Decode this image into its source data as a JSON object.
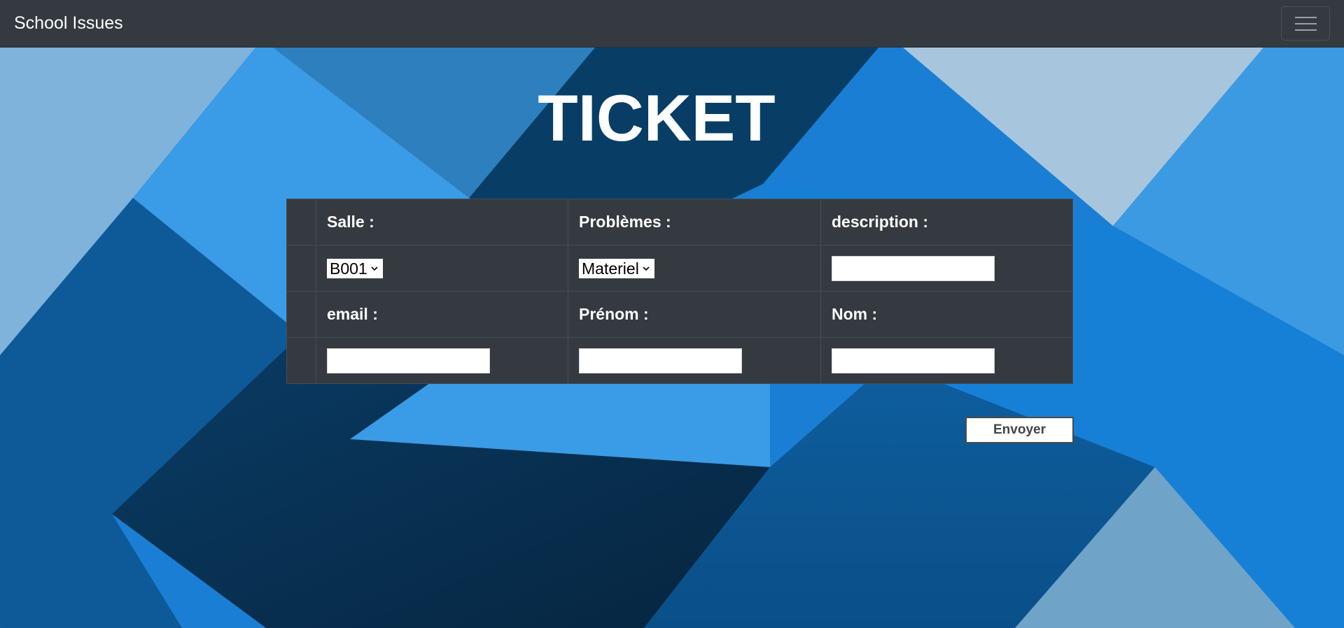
{
  "navbar": {
    "brand": "School Issues",
    "toggler_icon": "hamburger-icon"
  },
  "page": {
    "title": "TICKET"
  },
  "form": {
    "labels": {
      "salle": "Salle :",
      "problemes": "Problèmes :",
      "description": "description :",
      "email": "email :",
      "prenom": "Prénom :",
      "nom": "Nom :"
    },
    "salle_value": "B001",
    "probleme_value": "Materiel",
    "description_value": "",
    "email_value": "",
    "prenom_value": "",
    "nom_value": "",
    "submit_label": "Envoyer"
  },
  "colors": {
    "navbar_bg": "#343a40",
    "table_bg": "#343a40",
    "background_blue": "#1a7fd4"
  }
}
